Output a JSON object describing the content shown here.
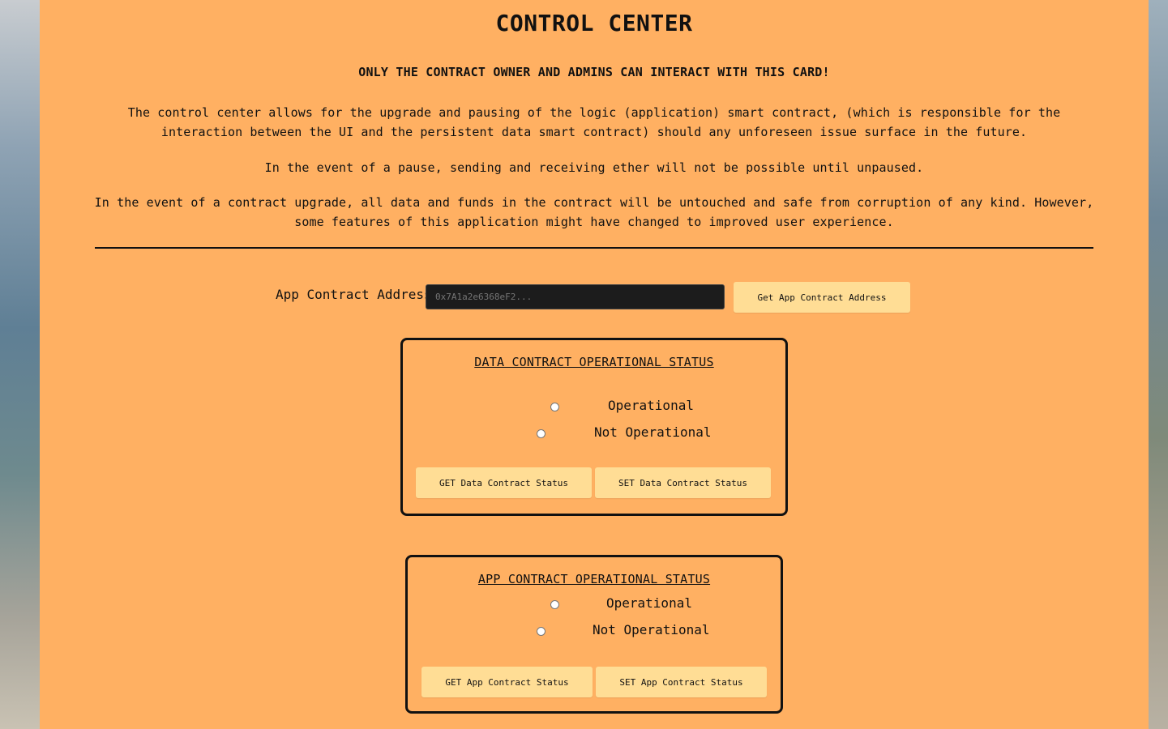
{
  "title": "CONTROL CENTER",
  "warning": "ONLY THE CONTRACT OWNER AND ADMINS CAN INTERACT WITH THIS CARD!",
  "paragraphs": [
    "The control center allows for the upgrade and pausing of the logic (application) smart contract, (which is responsible for the interaction between the UI and the persistent data smart contract) should any unforeseen issue surface in the future.",
    "In the event of a pause, sending and receiving ether will not be possible until unpaused.",
    "In the event of a contract upgrade, all data and funds in the contract will be untouched and safe from corruption of any kind. However, some features of this application might have changed to improved user experience."
  ],
  "app_address": {
    "label": "App Contract Address",
    "placeholder": "0x7A1a2e6368eF2...",
    "button": "Get App Contract Address"
  },
  "data_status": {
    "title": "DATA CONTRACT OPERATIONAL STATUS",
    "options": [
      "Operational",
      "Not Operational"
    ],
    "get_button": "GET Data Contract Status",
    "set_button": "SET Data Contract Status"
  },
  "app_status": {
    "title": "APP CONTRACT OPERATIONAL STATUS",
    "options": [
      "Operational",
      "Not Operational"
    ],
    "get_button": "GET App Contract Status",
    "set_button": "SET App Contract Status"
  },
  "colors": {
    "card_background": "#ffb062",
    "button_background": "#ffdd95",
    "input_background": "#1c1c1c",
    "text": "#111111"
  }
}
